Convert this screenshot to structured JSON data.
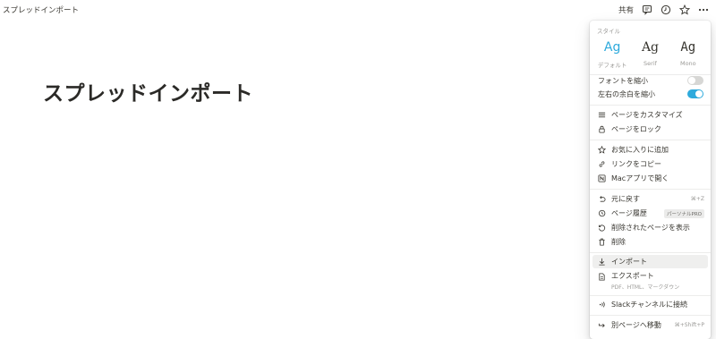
{
  "topbar": {
    "breadcrumb": "スプレッドインポート",
    "share_label": "共有",
    "icons": [
      "comment-icon",
      "clock-icon",
      "star-icon",
      "more-icon"
    ]
  },
  "page": {
    "title": "スプレッドインポート"
  },
  "menu": {
    "style_section_title": "スタイル",
    "styles": [
      {
        "glyph": "Ag",
        "label": "デフォルト",
        "selected": true
      },
      {
        "glyph": "Ag",
        "label": "Serif",
        "selected": false
      },
      {
        "glyph": "Ag",
        "label": "Mono",
        "selected": false
      }
    ],
    "toggles": [
      {
        "label": "フォントを縮小",
        "on": false
      },
      {
        "label": "左右の余白を縮小",
        "on": true
      }
    ],
    "customize": {
      "label": "ページをカスタマイズ",
      "icon": "list-icon"
    },
    "lock": {
      "label": "ページをロック",
      "icon": "lock-icon"
    },
    "favorite": {
      "label": "お気に入りに追加",
      "icon": "star-icon"
    },
    "copy_link": {
      "label": "リンクをコピー",
      "icon": "link-icon"
    },
    "open_mac": {
      "label": "Macアプリで開く",
      "icon": "notion-icon"
    },
    "undo": {
      "label": "元に戻す",
      "shortcut": "⌘+Z",
      "icon": "undo-icon"
    },
    "history": {
      "label": "ページ履歴",
      "badge": "パーソナルPRO",
      "icon": "history-icon"
    },
    "deleted": {
      "label": "削除されたページを表示",
      "icon": "restore-icon"
    },
    "delete": {
      "label": "削除",
      "icon": "trash-icon"
    },
    "import": {
      "label": "インポート",
      "icon": "download-icon"
    },
    "export": {
      "label": "エクスポート",
      "sub": "PDF、HTML、マークダウン",
      "icon": "export-icon"
    },
    "slack": {
      "label": "Slackチャンネルに接続",
      "icon": "signal-icon"
    },
    "move": {
      "label": "別ページへ移動",
      "shortcut": "⌘+Shift+P",
      "icon": "move-icon"
    }
  },
  "colors": {
    "accent": "#2eaadc",
    "text": "#37352f",
    "muted": "#9b9a97"
  }
}
